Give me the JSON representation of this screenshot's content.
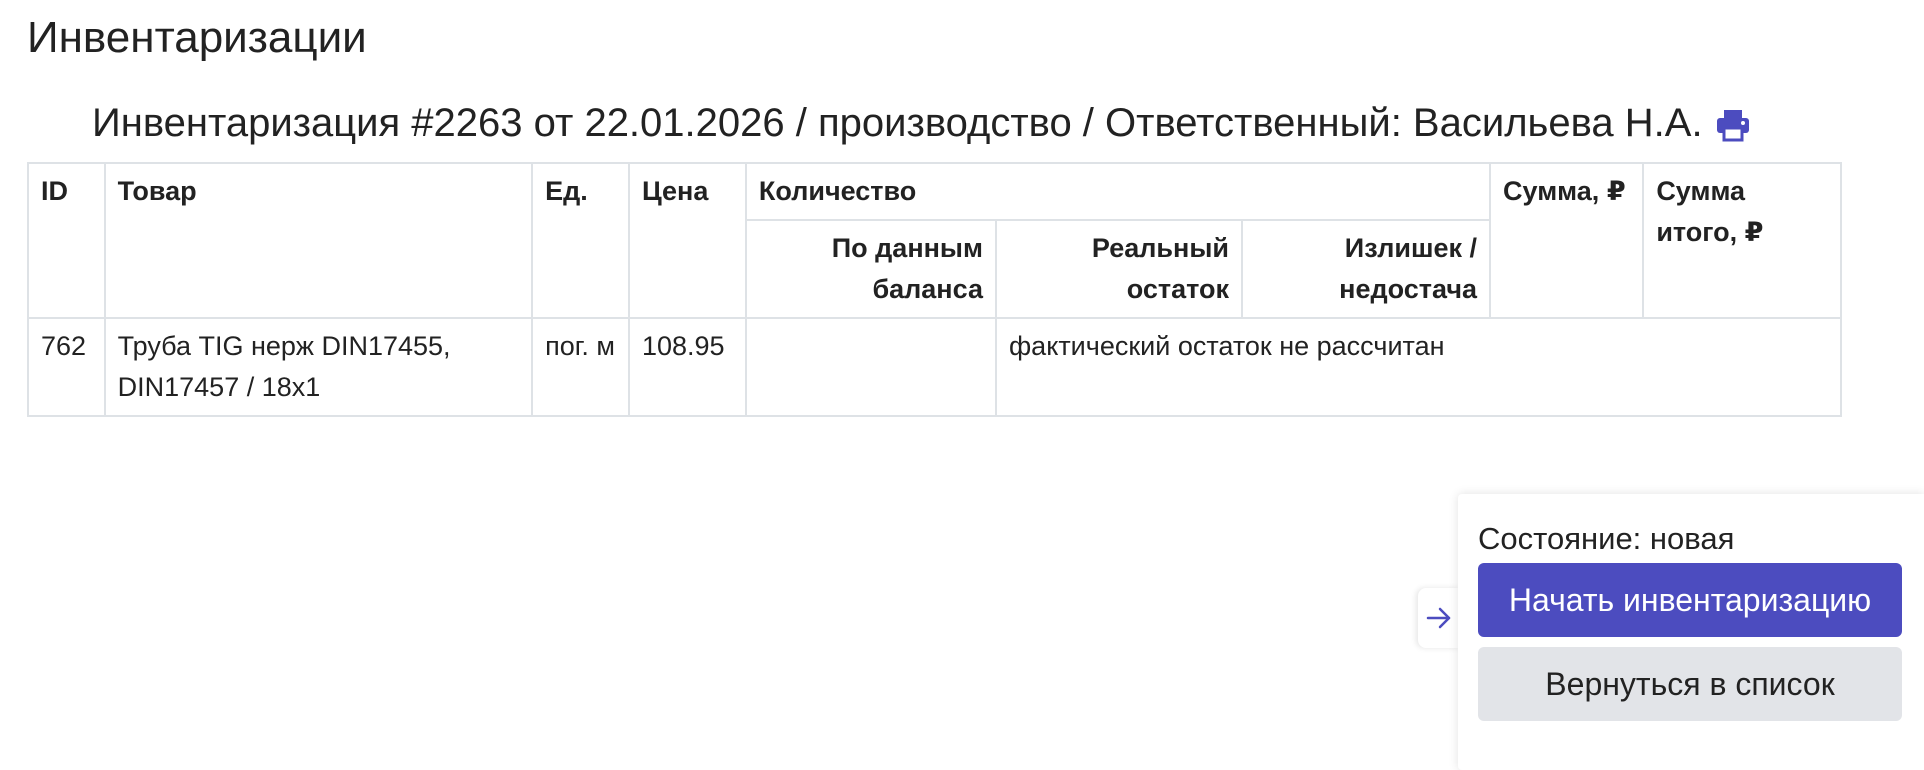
{
  "page": {
    "title": "Инвентаризации"
  },
  "header": {
    "text": "Инвентаризация #2263 от 22.01.2026 / производство / Ответственный: Васильева Н.А.",
    "print_icon": "printer-icon"
  },
  "table": {
    "headers": {
      "id": "ID",
      "item": "Товар",
      "unit": "Ед.",
      "price": "Цена",
      "quantity": "Количество",
      "balance": "По данным баланса",
      "real": "Реальный остаток",
      "diff": "Излишек / недостача",
      "sum": "Сумма, ₽",
      "total": "Сумма итого, ₽"
    },
    "rows": [
      {
        "id": "762",
        "item": "Труба TIG нерж DIN17455, DIN17457 / 18x1",
        "unit": "пог. м",
        "price": "108.95",
        "balance": "",
        "note": "фактический остаток не рассчитан"
      }
    ]
  },
  "panel": {
    "toggle_icon": "arrow-right-icon",
    "status": "Состояние: новая",
    "start_button": "Начать инвентаризацию",
    "back_button": "Вернуться в список"
  },
  "colors": {
    "accent": "#4c4cbf",
    "secondary_button": "#e2e4e8",
    "border": "#dee2e6",
    "text": "#222222"
  }
}
